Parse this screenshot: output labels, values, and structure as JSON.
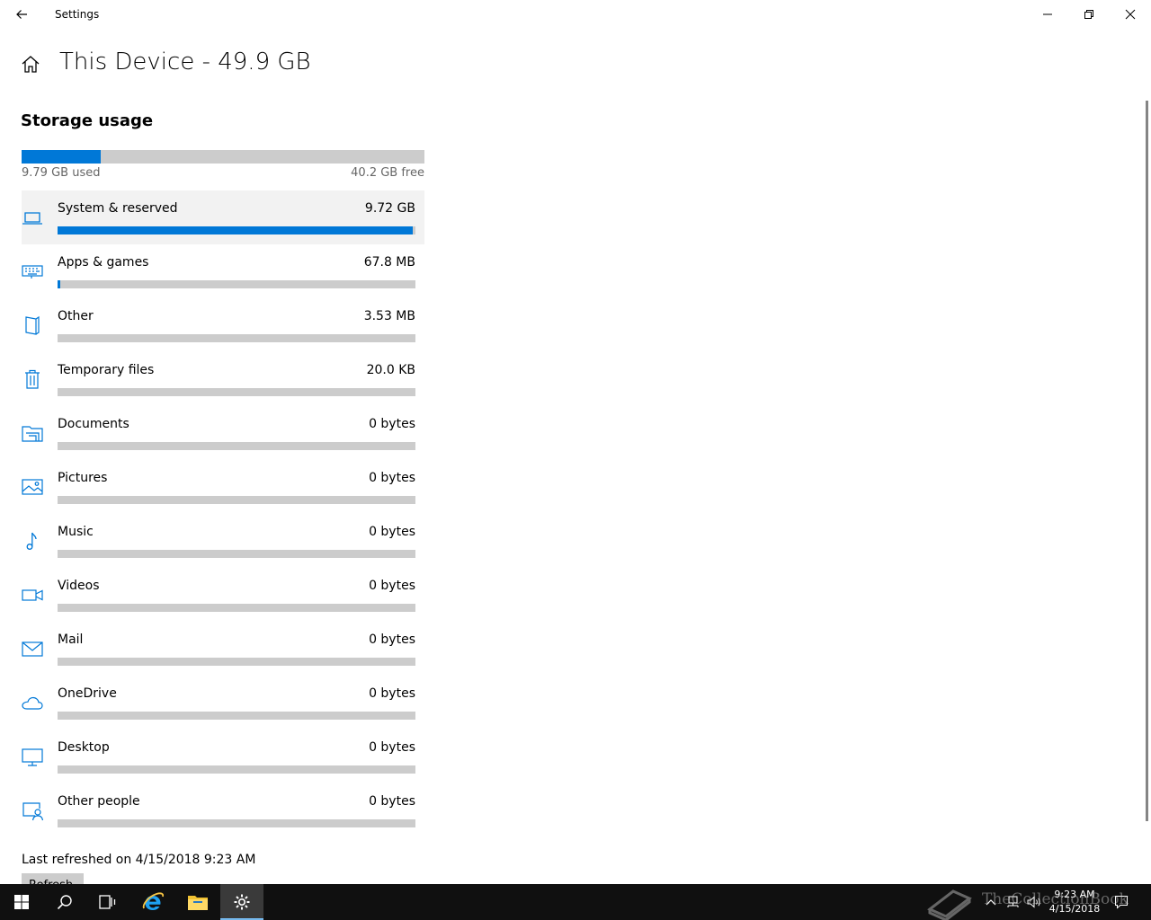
{
  "titlebar": {
    "title": "Settings",
    "icons": {
      "back": "back-arrow-icon",
      "minimize": "minimize-icon",
      "restore": "restore-icon",
      "close": "close-icon"
    }
  },
  "header": {
    "home_icon": "home-icon",
    "title": "This Device - 49.9 GB"
  },
  "storage": {
    "section_title": "Storage usage",
    "used_fraction": 0.196,
    "used_label": "9.79 GB used",
    "free_label": "40.2 GB free",
    "categories": [
      {
        "name": "System & reserved",
        "size": "9.72 GB",
        "fraction": 0.993,
        "icon": "laptop-icon",
        "selected": true
      },
      {
        "name": "Apps & games",
        "size": "67.8 MB",
        "fraction": 0.007,
        "icon": "keyboard-icon"
      },
      {
        "name": "Other",
        "size": "3.53 MB",
        "fraction": 0,
        "icon": "other-document-icon"
      },
      {
        "name": "Temporary files",
        "size": "20.0 KB",
        "fraction": 0,
        "icon": "trash-icon"
      },
      {
        "name": "Documents",
        "size": "0 bytes",
        "fraction": 0,
        "icon": "documents-folder-icon"
      },
      {
        "name": "Pictures",
        "size": "0 bytes",
        "fraction": 0,
        "icon": "picture-icon"
      },
      {
        "name": "Music",
        "size": "0 bytes",
        "fraction": 0,
        "icon": "music-note-icon"
      },
      {
        "name": "Videos",
        "size": "0 bytes",
        "fraction": 0,
        "icon": "video-camera-icon"
      },
      {
        "name": "Mail",
        "size": "0 bytes",
        "fraction": 0,
        "icon": "mail-icon"
      },
      {
        "name": "OneDrive",
        "size": "0 bytes",
        "fraction": 0,
        "icon": "cloud-icon"
      },
      {
        "name": "Desktop",
        "size": "0 bytes",
        "fraction": 0,
        "icon": "monitor-icon"
      },
      {
        "name": "Other people",
        "size": "0 bytes",
        "fraction": 0,
        "icon": "other-people-icon"
      }
    ],
    "last_refreshed": "Last refreshed on 4/15/2018 9:23 AM",
    "refresh_button": "Refresh"
  },
  "taskbar": {
    "items": [
      "start-icon",
      "search-icon",
      "task-view-icon",
      "internet-explorer-icon",
      "file-explorer-icon",
      "settings-gear-icon"
    ],
    "active_item": "settings-gear-icon",
    "tray_icons": [
      "chevron-up-icon",
      "network-icon",
      "volume-icon",
      "action-center-icon"
    ],
    "clock": {
      "time": "9:23 AM",
      "date": "4/15/2018"
    }
  },
  "watermark": {
    "text": "TheCollectionBook",
    "icon": "book-icon"
  },
  "colors": {
    "accent": "#0078d7",
    "bar_track": "#cccccc",
    "selected_row": "#f2f2f2",
    "taskbar": "#101010"
  }
}
